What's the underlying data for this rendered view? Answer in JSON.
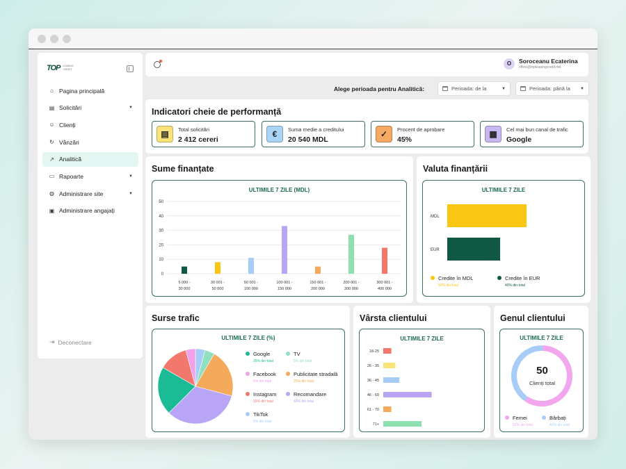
{
  "app": {
    "logo_mark": "TOP",
    "logo_sub": "LEASING CREDIT",
    "user": {
      "initial": "O",
      "name": "Soroceanu Ecaterina",
      "email": "office@topleasingcredit.md"
    }
  },
  "sidebar": {
    "items": [
      {
        "label": "Pagina principală",
        "icon": "home-icon"
      },
      {
        "label": "Solicitări",
        "icon": "document-icon",
        "chevron": true
      },
      {
        "label": "Clienți",
        "icon": "contact-icon"
      },
      {
        "label": "Vânzări",
        "icon": "refresh-icon"
      },
      {
        "label": "Analitică",
        "icon": "analytics-icon",
        "active": true
      },
      {
        "label": "Rapoarte",
        "icon": "folder-icon",
        "chevron": true
      },
      {
        "label": "Administrare site",
        "icon": "globe-icon",
        "chevron": true
      },
      {
        "label": "Administrare angajați",
        "icon": "briefcase-icon"
      }
    ],
    "logout": "Deconectare"
  },
  "period": {
    "label": "Alege perioada pentru Analitică:",
    "from_placeholder": "Perioada: de la",
    "to_placeholder": "Perioada: până la"
  },
  "kpi": {
    "title": "Indicatori cheie de performanță",
    "cards": [
      {
        "label": "Total solicitări",
        "value": "2 412 cereri",
        "icon": "document-icon",
        "color": "#fbe37a"
      },
      {
        "label": "Suma medie a creditului",
        "value": "20 540 MDL",
        "icon": "euro-icon",
        "color": "#a9d4f5"
      },
      {
        "label": "Procent de aprobare",
        "value": "45%",
        "icon": "shield-check-icon",
        "color": "#f5a964"
      },
      {
        "label": "Cel mai bun canal de trafic",
        "value": "Google",
        "icon": "browser-icon",
        "color": "#c7b8f3"
      }
    ]
  },
  "sume": {
    "title": "Sume finanțate",
    "chart_head": "ULTIMILE 7 ZILE (MDL)"
  },
  "valuta": {
    "title": "Valuta finanțării",
    "chart_head": "ULTIMILE 7 ZILE",
    "legend": [
      {
        "label": "Credite în MDL",
        "sub": "60% din total",
        "color": "#f9c614"
      },
      {
        "label": "Credite în EUR",
        "sub": "40% din total",
        "color": "#0f5843"
      }
    ]
  },
  "surse": {
    "title": "Surse trafic",
    "chart_head": "ULTIMILE 7 ZILE (%)",
    "legend": [
      {
        "label": "Google",
        "sub": "25% din total",
        "color": "#1bbb95"
      },
      {
        "label": "TV",
        "sub": "5% din total",
        "color": "#8fe0c0"
      },
      {
        "label": "Facebook",
        "sub": "5% din total",
        "color": "#f3a0ea"
      },
      {
        "label": "Publicitate stradală",
        "sub": "25% din total",
        "color": "#f5a95a"
      },
      {
        "label": "Instagram",
        "sub": "15% din total",
        "color": "#f2786e"
      },
      {
        "label": "Recomandare",
        "sub": "40% din total",
        "color": "#b8a5f5"
      },
      {
        "label": "TikTok",
        "sub": "5% din total",
        "color": "#a7cdf7"
      }
    ]
  },
  "varsta": {
    "title": "Vârsta clientului",
    "chart_head": "ULTIMILE 7 ZILE"
  },
  "gen": {
    "title": "Genul clientului",
    "chart_head": "ULTIMILE 7 ZILE",
    "total_value": "50",
    "total_label": "Clienți total",
    "legend": [
      {
        "label": "Femei",
        "sub": "60% din total",
        "color": "#f2a6ee"
      },
      {
        "label": "Bărbați",
        "sub": "40% din total",
        "color": "#a7cdf7"
      }
    ]
  },
  "chart_data": [
    {
      "type": "bar",
      "ylim": [
        0,
        50
      ],
      "yticks": [
        "50",
        "40",
        "30",
        "20",
        "10",
        "0"
      ],
      "categories": [
        "5 000 - 30 000",
        "30 001 - 50 000",
        "50 001 - 100 000",
        "100 001 - 150 000",
        "150 001 - 200 000",
        "200 001 - 300 000",
        "300 001 - 400 000"
      ],
      "values": [
        5,
        8,
        11,
        33,
        5,
        27,
        18
      ],
      "colors": [
        "#0f5843",
        "#f9c614",
        "#a7cdf7",
        "#b8a5f5",
        "#f5a95a",
        "#8fe0b0",
        "#f2786e"
      ]
    },
    {
      "type": "bar",
      "orientation": "horizontal",
      "categories": [
        "MDL",
        "EUR"
      ],
      "values": [
        60,
        40
      ],
      "colors": [
        "#f9c614",
        "#0f5843"
      ]
    },
    {
      "type": "pie",
      "categories": [
        "Google",
        "TV",
        "Facebook",
        "Publicitate stradală",
        "Instagram",
        "Recomandare",
        "TikTok"
      ],
      "values": [
        25,
        5,
        5,
        25,
        15,
        40,
        5
      ],
      "colors": [
        "#1bbb95",
        "#8fe0c0",
        "#f3a0ea",
        "#f5a95a",
        "#f2786e",
        "#b8a5f5",
        "#a7cdf7"
      ]
    },
    {
      "type": "bar",
      "orientation": "horizontal",
      "categories": [
        "18-25",
        "26 - 35",
        "36 - 45",
        "46 - 60",
        "61 - 70",
        "71+"
      ],
      "values": [
        4,
        6,
        8,
        24,
        4,
        19
      ],
      "colors": [
        "#f2786e",
        "#fbe37a",
        "#a7cdf7",
        "#b8a5f5",
        "#f5a95a",
        "#8fe0b0"
      ]
    },
    {
      "type": "pie",
      "style": "donut",
      "categories": [
        "Femei",
        "Bărbați"
      ],
      "values": [
        60,
        40
      ],
      "colors": [
        "#f2a6ee",
        "#a7cdf7"
      ]
    }
  ]
}
